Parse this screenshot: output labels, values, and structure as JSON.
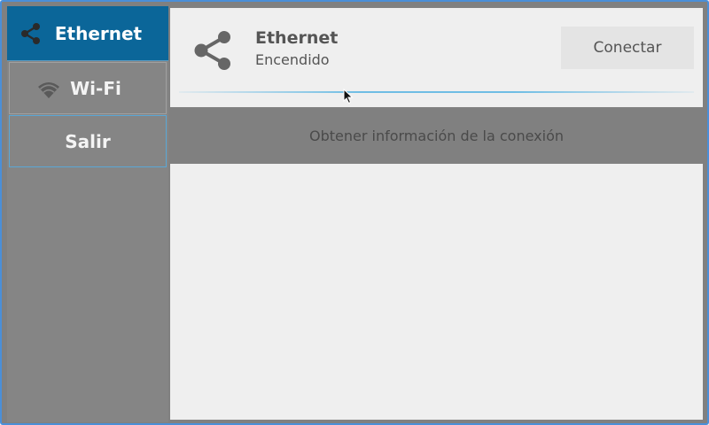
{
  "sidebar": {
    "items": [
      {
        "label": "Ethernet",
        "icon": "share-icon",
        "active": true
      },
      {
        "label": "Wi-Fi",
        "icon": "wifi-icon",
        "active": false
      },
      {
        "label": "Salir",
        "icon": "",
        "active": false
      }
    ]
  },
  "main": {
    "icon": "share-icon",
    "title": "Ethernet",
    "status": "Encendido",
    "connect_label": "Conectar",
    "info_label": "Obtener información de la conexión"
  },
  "colors": {
    "accent": "#0b6699",
    "sidebar_bg": "#858585",
    "content_bg": "#efefef",
    "frame_border": "#4a8fd8"
  }
}
